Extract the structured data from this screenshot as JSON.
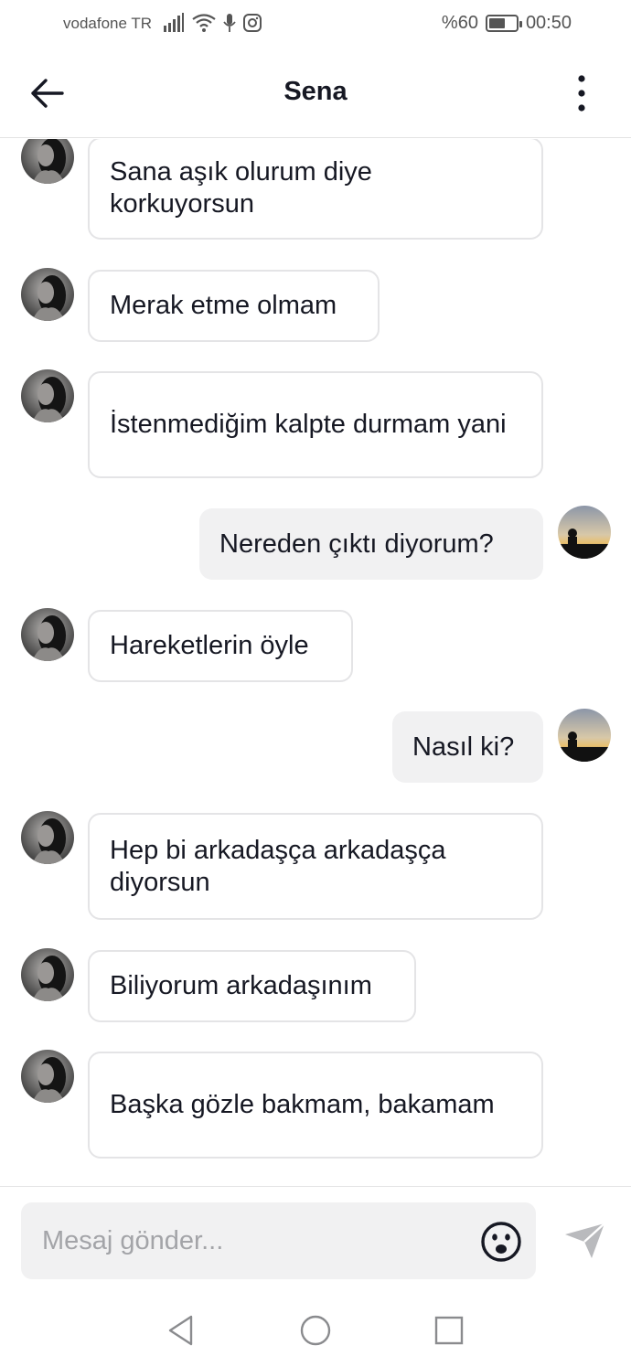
{
  "status_bar": {
    "carrier": "vodafone TR",
    "battery_text": "%60",
    "battery_level": 0.6,
    "time": "00:50",
    "icons": [
      "signal-icon",
      "wifi-icon",
      "microphone-icon",
      "instagram-icon",
      "battery-icon"
    ]
  },
  "header": {
    "title": "Sena",
    "back_icon": "arrow-left-icon",
    "more_icon": "more-vertical-icon"
  },
  "messages": [
    {
      "side": "in",
      "text": "Sana aşık olurum diye korkuyorsun"
    },
    {
      "side": "in",
      "text": "Merak etme olmam"
    },
    {
      "side": "in",
      "text": "İstenmediğim kalpte durmam yani"
    },
    {
      "side": "out",
      "text": "Nereden çıktı diyorum?"
    },
    {
      "side": "in",
      "text": "Hareketlerin öyle"
    },
    {
      "side": "out",
      "text": "Nasıl ki?"
    },
    {
      "side": "in",
      "text": "Hep bi arkadaşça arkadaşça diyorsun"
    },
    {
      "side": "in",
      "text": "Biliyorum arkadaşınım"
    },
    {
      "side": "in",
      "text": "Başka gözle bakmam, bakamam"
    }
  ],
  "composer": {
    "placeholder": "Mesaj gönder...",
    "emoji_icon": "emoji-icon",
    "send_icon": "send-icon"
  },
  "nav": {
    "icons": [
      "nav-back-icon",
      "nav-home-icon",
      "nav-recents-icon"
    ]
  },
  "colors": {
    "incoming_border": "#e4e4e6",
    "outgoing_bg": "#f1f1f2",
    "text": "#161823",
    "placeholder": "#a3a4a8"
  }
}
